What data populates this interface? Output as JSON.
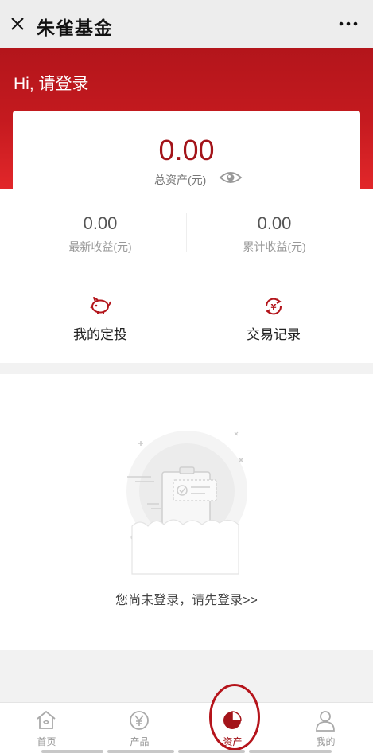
{
  "titlebar": {
    "title": "朱雀基金",
    "close_icon": "close-icon",
    "more_icon": "more-dots-icon"
  },
  "header": {
    "greeting": "Hi, 请登录"
  },
  "assets": {
    "total_value": "0.00",
    "total_label": "总资产(元)",
    "latest_income_value": "0.00",
    "latest_income_label": "最新收益(元)",
    "cumulative_income_value": "0.00",
    "cumulative_income_label": "累计收益(元)"
  },
  "quick_actions": [
    {
      "label": "我的定投",
      "icon": "piggy-bank-icon"
    },
    {
      "label": "交易记录",
      "icon": "yen-cycle-icon"
    }
  ],
  "empty_state": {
    "message": "您尚未登录，请先登录>>"
  },
  "tabbar": {
    "items": [
      {
        "label": "首页",
        "icon": "home-icon"
      },
      {
        "label": "产品",
        "icon": "yen-circle-icon"
      },
      {
        "label": "资产",
        "icon": "pie-chart-icon"
      },
      {
        "label": "我的",
        "icon": "person-icon"
      }
    ],
    "active": "资产"
  },
  "colors": {
    "brand_red": "#b3151b",
    "accent_text": "#a3141a",
    "titlebar_bg": "#ededed"
  }
}
